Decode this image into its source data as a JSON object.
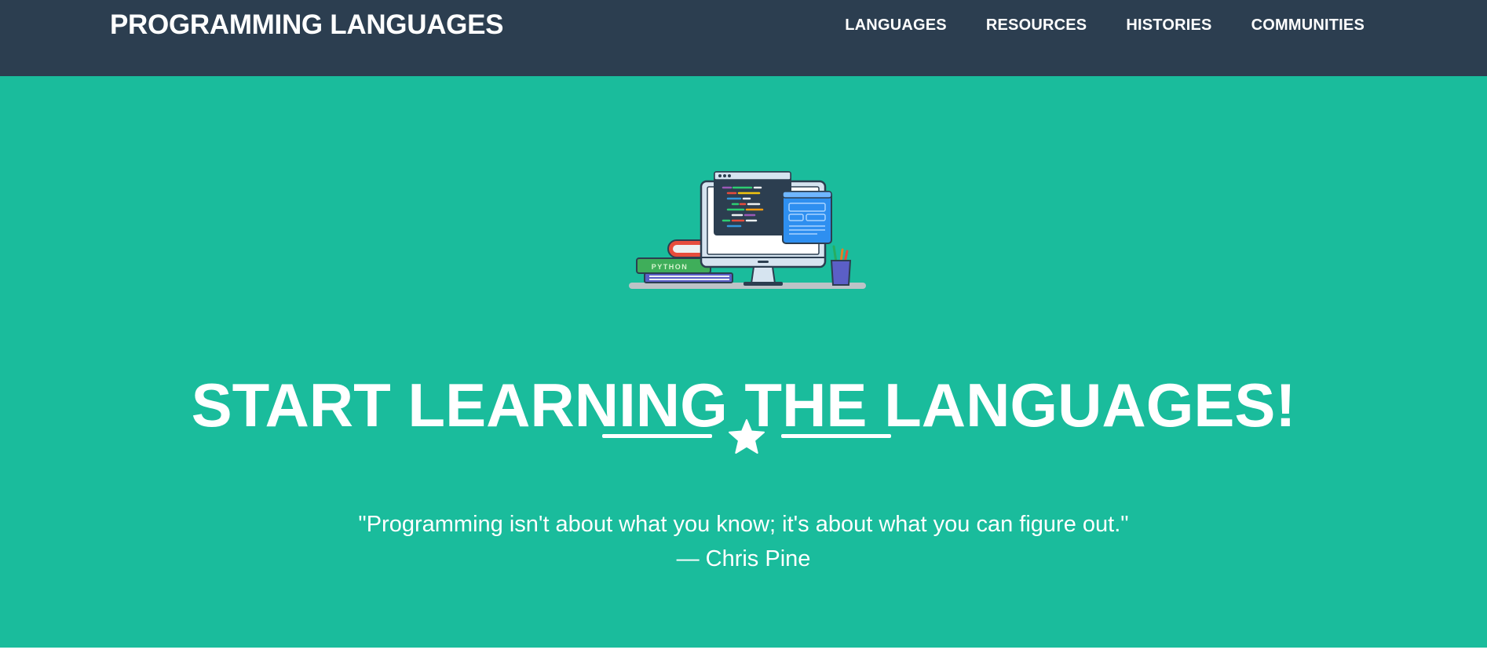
{
  "navbar": {
    "brand": "PROGRAMMING LANGUAGES",
    "links": [
      "LANGUAGES",
      "RESOURCES",
      "HISTORIES",
      "COMMUNITIES"
    ]
  },
  "masthead": {
    "illustration_book_label": "PYTHON",
    "headline": "START LEARNING THE LANGUAGES!",
    "divider_icon": "star-icon",
    "quote": "\"Programming isn't about what you know; it's about what you can figure out.\"",
    "attribution": "— Chris Pine"
  },
  "colors": {
    "navbar_bg": "#2c3e50",
    "masthead_bg": "#1abc9c",
    "text": "#ffffff"
  }
}
